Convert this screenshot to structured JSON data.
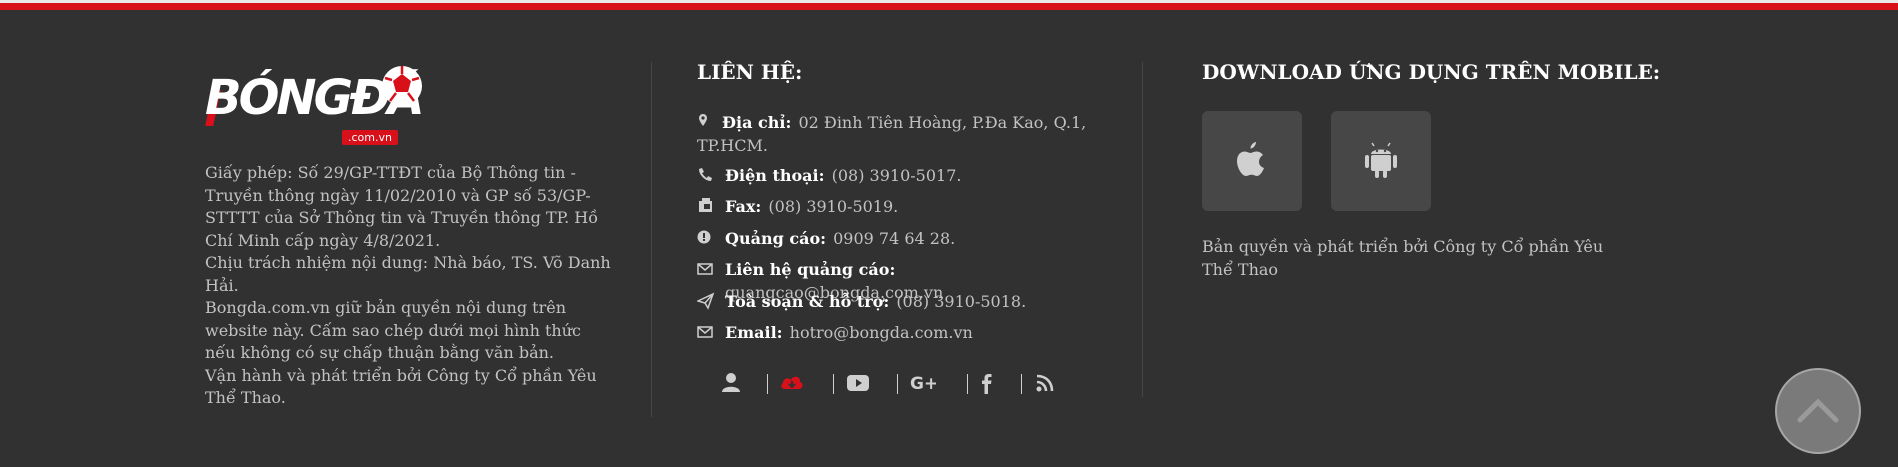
{
  "logo": {
    "text": "BÓNGĐÁ",
    "sub": ".com.vn"
  },
  "license_lines": [
    "Giấy phép: Số 29/GP-TTĐT của Bộ Thông tin - Truyền thông ngày 11/02/2010 và GP số 53/GP-STTTT của Sở Thông tin và Truyền thông TP. Hồ Chí Minh cấp ngày 4/8/2021.",
    "Chịu trách nhiệm nội dung: Nhà báo, TS. Võ Danh Hải.",
    "Bongda.com.vn giữ bản quyền nội dung trên website này. Cấm sao chép dưới mọi hình thức nếu không có sự chấp thuận bằng văn bản.",
    "Vận hành và phát triển bởi Công ty Cổ phần Yêu Thể Thao."
  ],
  "contact": {
    "heading": "LIÊN HỆ:",
    "address": {
      "label": "Địa chỉ:",
      "value": "02 Đinh Tiên Hoàng, P.Đa Kao, Q.1, TP.HCM."
    },
    "phone": {
      "label": "Điện thoại:",
      "value": "(08) 3910-5017."
    },
    "fax": {
      "label": "Fax:",
      "value": "(08) 3910-5019."
    },
    "ads": {
      "label": "Quảng cáo:",
      "value": "0909 74 64 28."
    },
    "ads_contact": {
      "label": "Liên hệ quảng cáo:",
      "value": "quangcao@bongda.com.vn"
    },
    "office": {
      "label": "Toà soạn & hỗ trợ:",
      "value": "(08) 3910-5018."
    },
    "email": {
      "label": "Email:",
      "value": "hotro@bongda.com.vn"
    }
  },
  "socials": [
    "user-icon",
    "cloud-download-icon",
    "youtube-icon",
    "google-plus-icon",
    "facebook-icon",
    "rss-icon"
  ],
  "download": {
    "heading": "DOWNLOAD ỨNG DỤNG TRÊN MOBILE:",
    "apps": [
      "apple-icon",
      "android-icon"
    ],
    "copyright": "Bản quyền và phát triển bởi Công ty Cổ phần Yêu Thể Thao"
  },
  "colors": {
    "background": "#313131",
    "accent": "#d8101a"
  }
}
